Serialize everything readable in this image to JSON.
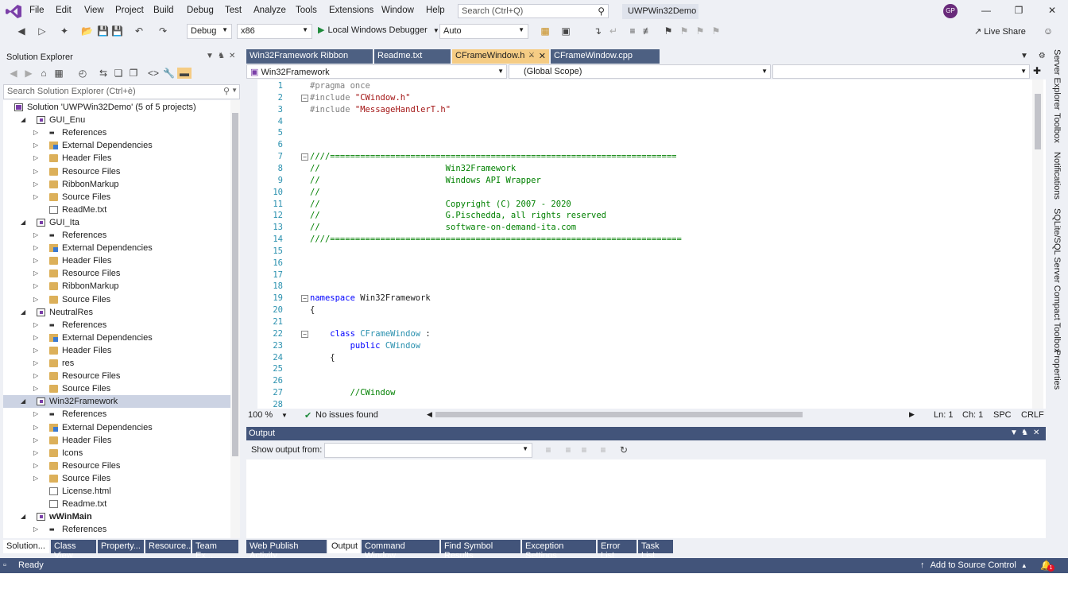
{
  "menu": [
    "File",
    "Edit",
    "View",
    "Project",
    "Build",
    "Debug",
    "Test",
    "Analyze",
    "Tools",
    "Extensions",
    "Window",
    "Help"
  ],
  "search": {
    "placeholder": "Search (Ctrl+Q)"
  },
  "solution_name": "UWPWin32Demo",
  "user_initials": "GP",
  "toolbar": {
    "config": "Debug",
    "platform": "x86",
    "debugger": "Local Windows Debugger",
    "debug_target": "Auto",
    "live_share": "Live Share"
  },
  "solution_explorer": {
    "title": "Solution Explorer",
    "search_placeholder": "Search Solution Explorer (Ctrl+è)",
    "tree": [
      {
        "label": "Solution 'UWPWin32Demo' (5 of 5 projects)",
        "level": 0,
        "icon": "solution-icon",
        "exp": ""
      },
      {
        "label": "GUI_Enu",
        "level": 1,
        "icon": "project-icon",
        "exp": "expanded"
      },
      {
        "label": "References",
        "level": 2,
        "icon": "references-icon",
        "exp": "collapsed"
      },
      {
        "label": "External Dependencies",
        "level": 2,
        "icon": "external-deps-icon",
        "exp": "collapsed"
      },
      {
        "label": "Header Files",
        "level": 2,
        "icon": "folder-icon",
        "exp": "collapsed"
      },
      {
        "label": "Resource Files",
        "level": 2,
        "icon": "folder-icon",
        "exp": "collapsed"
      },
      {
        "label": "RibbonMarkup",
        "level": 2,
        "icon": "folder-icon",
        "exp": "collapsed"
      },
      {
        "label": "Source Files",
        "level": 2,
        "icon": "folder-icon",
        "exp": "collapsed"
      },
      {
        "label": "ReadMe.txt",
        "level": 2,
        "icon": "file-icon",
        "exp": ""
      },
      {
        "label": "GUI_Ita",
        "level": 1,
        "icon": "project-icon",
        "exp": "expanded"
      },
      {
        "label": "References",
        "level": 2,
        "icon": "references-icon",
        "exp": "collapsed"
      },
      {
        "label": "External Dependencies",
        "level": 2,
        "icon": "external-deps-icon",
        "exp": "collapsed"
      },
      {
        "label": "Header Files",
        "level": 2,
        "icon": "folder-icon",
        "exp": "collapsed"
      },
      {
        "label": "Resource Files",
        "level": 2,
        "icon": "folder-icon",
        "exp": "collapsed"
      },
      {
        "label": "RibbonMarkup",
        "level": 2,
        "icon": "folder-icon",
        "exp": "collapsed"
      },
      {
        "label": "Source Files",
        "level": 2,
        "icon": "folder-icon",
        "exp": "collapsed"
      },
      {
        "label": "NeutralRes",
        "level": 1,
        "icon": "project-icon",
        "exp": "expanded"
      },
      {
        "label": "References",
        "level": 2,
        "icon": "references-icon",
        "exp": "collapsed"
      },
      {
        "label": "External Dependencies",
        "level": 2,
        "icon": "external-deps-icon",
        "exp": "collapsed"
      },
      {
        "label": "Header Files",
        "level": 2,
        "icon": "folder-icon",
        "exp": "collapsed"
      },
      {
        "label": "res",
        "level": 2,
        "icon": "folder-icon",
        "exp": "collapsed"
      },
      {
        "label": "Resource Files",
        "level": 2,
        "icon": "folder-icon",
        "exp": "collapsed"
      },
      {
        "label": "Source Files",
        "level": 2,
        "icon": "folder-icon",
        "exp": "collapsed"
      },
      {
        "label": "Win32Framework",
        "level": 1,
        "icon": "project-icon",
        "exp": "expanded",
        "selected": true
      },
      {
        "label": "References",
        "level": 2,
        "icon": "references-icon",
        "exp": "collapsed"
      },
      {
        "label": "External Dependencies",
        "level": 2,
        "icon": "external-deps-icon",
        "exp": "collapsed"
      },
      {
        "label": "Header Files",
        "level": 2,
        "icon": "folder-icon",
        "exp": "collapsed"
      },
      {
        "label": "Icons",
        "level": 2,
        "icon": "folder-icon",
        "exp": "collapsed"
      },
      {
        "label": "Resource Files",
        "level": 2,
        "icon": "folder-icon",
        "exp": "collapsed"
      },
      {
        "label": "Source Files",
        "level": 2,
        "icon": "folder-icon",
        "exp": "collapsed"
      },
      {
        "label": "License.html",
        "level": 2,
        "icon": "file-icon",
        "exp": ""
      },
      {
        "label": "Readme.txt",
        "level": 2,
        "icon": "file-icon",
        "exp": ""
      },
      {
        "label": "wWinMain",
        "level": 1,
        "icon": "project-icon",
        "exp": "expanded",
        "bold": true
      },
      {
        "label": "References",
        "level": 2,
        "icon": "references-icon",
        "exp": "collapsed"
      }
    ],
    "bottom_tabs": [
      "Solution...",
      "Class View",
      "Property...",
      "Resource...",
      "Team Ex..."
    ]
  },
  "doc_tabs": [
    {
      "label": "Win32Framework Ribbon",
      "active": false
    },
    {
      "label": "Readme.txt",
      "active": false
    },
    {
      "label": "CFrameWindow.h",
      "active": true
    },
    {
      "label": "CFrameWindow.cpp",
      "active": false
    }
  ],
  "navbar": {
    "project": "Win32Framework",
    "scope": "(Global Scope)",
    "member": ""
  },
  "code_lines": [
    {
      "n": "1",
      "html": "<span class='pp'>#pragma once</span>",
      "fold": ""
    },
    {
      "n": "2",
      "html": "<span class='pp'>#include </span><span class='st'>\"CWindow.h\"</span>",
      "fold": "minus"
    },
    {
      "n": "3",
      "html": "<span class='pp'>#include </span><span class='st'>\"MessageHandlerT.h\"</span>",
      "fold": ""
    },
    {
      "n": "4",
      "html": "",
      "fold": ""
    },
    {
      "n": "5",
      "html": "",
      "fold": ""
    },
    {
      "n": "6",
      "html": "",
      "fold": ""
    },
    {
      "n": "7",
      "html": "<span class='cm'>////=====================================================================</span>",
      "fold": "minus"
    },
    {
      "n": "8",
      "html": "<span class='cm'>//                         Win32Framework</span>",
      "fold": ""
    },
    {
      "n": "9",
      "html": "<span class='cm'>//                         Windows API Wrapper</span>",
      "fold": ""
    },
    {
      "n": "10",
      "html": "<span class='cm'>//</span>",
      "fold": ""
    },
    {
      "n": "11",
      "html": "<span class='cm'>//                         Copyright (C) 2007 - 2020</span>",
      "fold": ""
    },
    {
      "n": "12",
      "html": "<span class='cm'>//                         G.Pischedda, all rights reserved</span>",
      "fold": ""
    },
    {
      "n": "13",
      "html": "<span class='cm'>//                         software-on-demand-ita.com</span>",
      "fold": ""
    },
    {
      "n": "14",
      "html": "<span class='cm'>////======================================================================</span>",
      "fold": ""
    },
    {
      "n": "15",
      "html": "",
      "fold": ""
    },
    {
      "n": "16",
      "html": "",
      "fold": ""
    },
    {
      "n": "17",
      "html": "",
      "fold": ""
    },
    {
      "n": "18",
      "html": "",
      "fold": ""
    },
    {
      "n": "19",
      "html": "<span class='kw'>namespace</span> Win32Framework",
      "fold": "minus"
    },
    {
      "n": "20",
      "html": "{",
      "fold": ""
    },
    {
      "n": "21",
      "html": "",
      "fold": ""
    },
    {
      "n": "22",
      "html": "    <span class='kw'>class</span> <span class='ty'>CFrameWindow</span> :",
      "fold": "minus"
    },
    {
      "n": "23",
      "html": "        <span class='kw'>public</span> <span class='ty'>CWindow</span>",
      "fold": ""
    },
    {
      "n": "24",
      "html": "    {",
      "fold": ""
    },
    {
      "n": "25",
      "html": "",
      "fold": ""
    },
    {
      "n": "26",
      "html": "",
      "fold": ""
    },
    {
      "n": "27",
      "html": "        <span class='cm'>//CWindow</span>",
      "fold": ""
    },
    {
      "n": "28",
      "html": "",
      "fold": ""
    }
  ],
  "editor_status": {
    "zoom": "100 %",
    "issues": "No issues found",
    "line": "Ln: 1",
    "col": "Ch: 1",
    "spc": "SPC",
    "eol": "CRLF"
  },
  "output": {
    "title": "Output",
    "show_from_label": "Show output from:",
    "show_from_value": ""
  },
  "bottom_tabs": [
    "Web Publish Activity",
    "Output",
    "Command Window",
    "Find Symbol Results",
    "Exception Settings",
    "Error List",
    "Task List"
  ],
  "side_tabs": [
    "Server Explorer",
    "Toolbox",
    "Notifications",
    "SQLite/SQL Server Compact Toolbox",
    "Properties"
  ],
  "status": {
    "ready": "Ready",
    "source_control": "Add to Source Control",
    "notifications_count": "1"
  },
  "colors": {
    "accent": "#42547a",
    "active_tab": "#f5cc84",
    "vs_purple": "#7b3fa8"
  }
}
